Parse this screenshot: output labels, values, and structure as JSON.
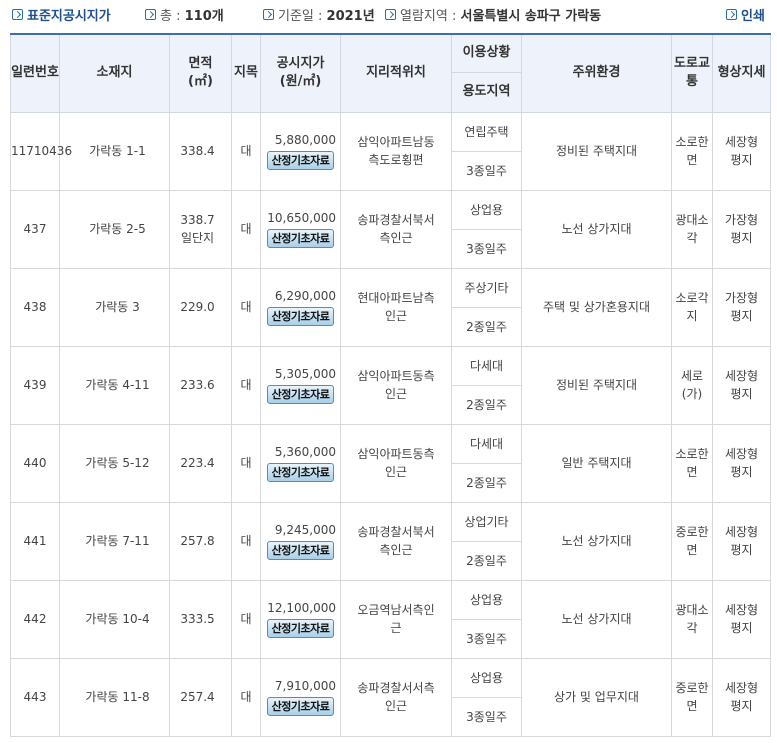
{
  "topbar": {
    "title": "표준지공시지가",
    "total_label": "총 :",
    "total_value": "110개",
    "base_label": "기준일 :",
    "base_value": "2021년",
    "region_label": "열람지역 :",
    "region_value": "서울특별시 송파구 가락동",
    "print_label": "인쇄"
  },
  "headers": {
    "serial": "일련번호",
    "address": "소재지",
    "area": "면적",
    "area_unit": "(㎡)",
    "jimok": "지목",
    "price": "공시지가",
    "price_unit": "(원/㎡)",
    "location": "지리적위치",
    "usage_status": "이용상황",
    "usage_zone": "용도지역",
    "surroundings": "주위환경",
    "road": "도로교통",
    "shape": "형상지세"
  },
  "button_label": "산정기초자료",
  "rows": [
    {
      "serial": "11710436",
      "address": "가락동 1-1",
      "area": "338.4",
      "area2": "",
      "jimok": "대",
      "price": "5,880,000",
      "location": "삼익아파트남동측도로횡편",
      "status": "연립주택",
      "zone": "3종일주",
      "surroundings": "정비된 주택지대",
      "road": "소로한면",
      "shape": "세장형평지"
    },
    {
      "serial": "437",
      "address": "가락동 2-5",
      "area": "338.7",
      "area2": "일단지",
      "jimok": "대",
      "price": "10,650,000",
      "location": "송파경찰서북서측인근",
      "status": "상업용",
      "zone": "3종일주",
      "surroundings": "노선 상가지대",
      "road": "광대소각",
      "shape": "가장형평지"
    },
    {
      "serial": "438",
      "address": "가락동 3",
      "area": "229.0",
      "area2": "",
      "jimok": "대",
      "price": "6,290,000",
      "location": "현대아파트남측인근",
      "status": "주상기타",
      "zone": "2종일주",
      "surroundings": "주택 및 상가혼용지대",
      "road": "소로각지",
      "shape": "가장형평지"
    },
    {
      "serial": "439",
      "address": "가락동 4-11",
      "area": "233.6",
      "area2": "",
      "jimok": "대",
      "price": "5,305,000",
      "location": "삼익아파트동측인근",
      "status": "다세대",
      "zone": "2종일주",
      "surroundings": "정비된 주택지대",
      "road": "세로(가)",
      "shape": "세장형평지"
    },
    {
      "serial": "440",
      "address": "가락동 5-12",
      "area": "223.4",
      "area2": "",
      "jimok": "대",
      "price": "5,360,000",
      "location": "삼익아파트동측인근",
      "status": "다세대",
      "zone": "2종일주",
      "surroundings": "일반 주택지대",
      "road": "소로한면",
      "shape": "세장형평지"
    },
    {
      "serial": "441",
      "address": "가락동 7-11",
      "area": "257.8",
      "area2": "",
      "jimok": "대",
      "price": "9,245,000",
      "location": "송파경찰서북서측인근",
      "status": "상업기타",
      "zone": "2종일주",
      "surroundings": "노선 상가지대",
      "road": "중로한면",
      "shape": "세장형평지"
    },
    {
      "serial": "442",
      "address": "가락동 10-4",
      "area": "333.5",
      "area2": "",
      "jimok": "대",
      "price": "12,100,000",
      "location": "오금역남서측인근",
      "status": "상업용",
      "zone": "3종일주",
      "surroundings": "노선 상가지대",
      "road": "광대소각",
      "shape": "세장형평지"
    },
    {
      "serial": "443",
      "address": "가락동 11-8",
      "area": "257.4",
      "area2": "",
      "jimok": "대",
      "price": "7,910,000",
      "location": "송파경찰서서측인근",
      "status": "상업용",
      "zone": "3종일주",
      "surroundings": "상가 및 업무지대",
      "road": "중로한면",
      "shape": "세장형평지"
    }
  ]
}
